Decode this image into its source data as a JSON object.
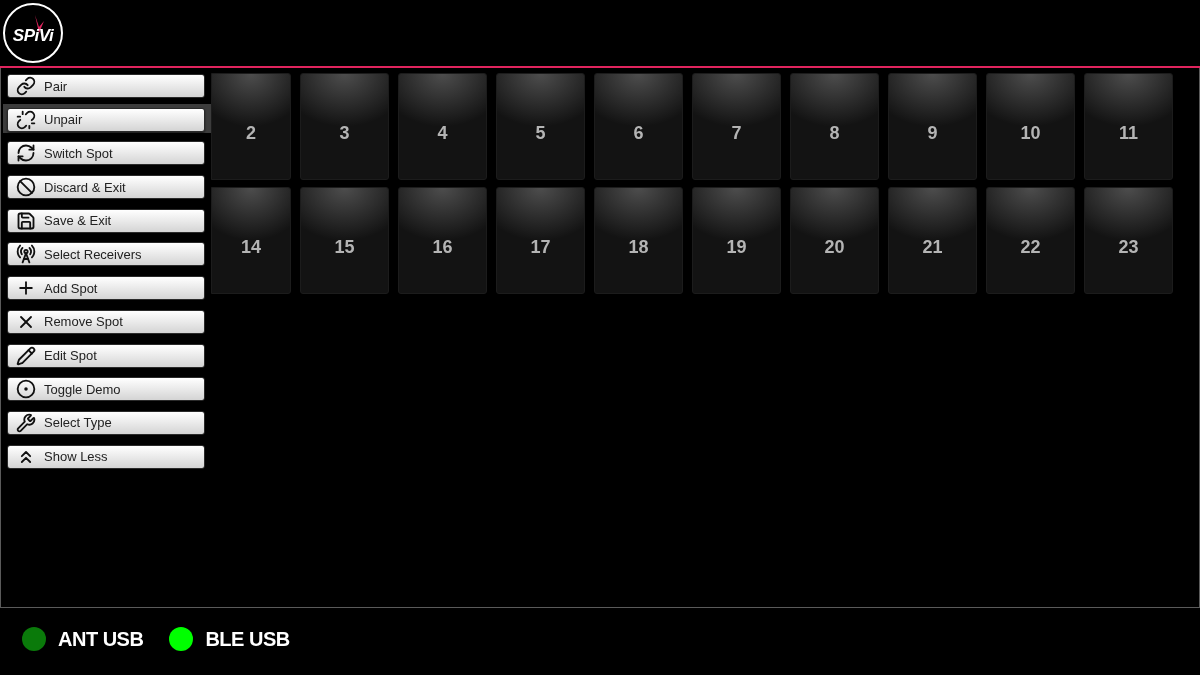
{
  "logo": {
    "text": "SPiVi"
  },
  "menu": {
    "items": [
      {
        "label": "Pair",
        "selected": false
      },
      {
        "label": "Unpair",
        "selected": true
      },
      {
        "label": "Switch Spot",
        "selected": false
      },
      {
        "label": "Discard & Exit",
        "selected": false
      },
      {
        "label": "Save & Exit",
        "selected": false
      },
      {
        "label": "Select Receivers",
        "selected": false
      },
      {
        "label": "Add Spot",
        "selected": false
      },
      {
        "label": "Remove Spot",
        "selected": false
      },
      {
        "label": "Edit Spot",
        "selected": false
      },
      {
        "label": "Toggle Demo",
        "selected": false
      },
      {
        "label": "Select Type",
        "selected": false
      },
      {
        "label": "Show Less",
        "selected": false
      }
    ]
  },
  "spots": {
    "rows": [
      [
        "2",
        "3",
        "4",
        "5",
        "6",
        "7",
        "8",
        "9",
        "10",
        "11"
      ],
      [
        "14",
        "15",
        "16",
        "17",
        "18",
        "19",
        "20",
        "21",
        "22",
        "23"
      ]
    ]
  },
  "status_bar": {
    "indicators": [
      {
        "label": "ANT USB",
        "color": "#0a7a0a"
      },
      {
        "label": "BLE USB",
        "color": "#00ff00"
      }
    ]
  }
}
